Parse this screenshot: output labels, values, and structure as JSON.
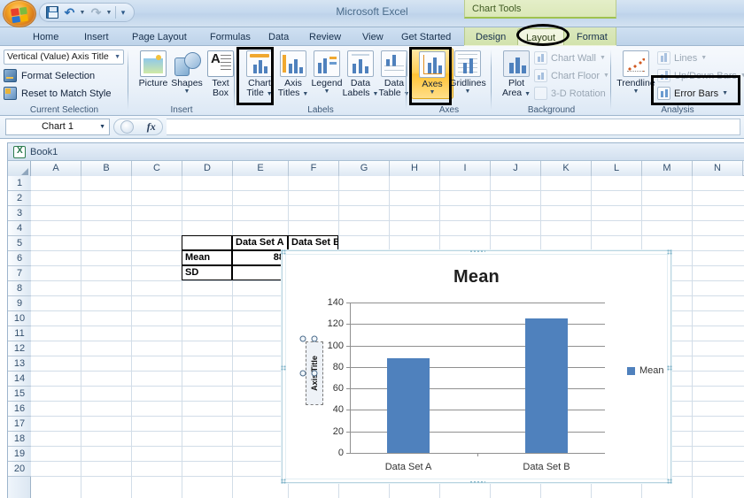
{
  "window": {
    "app_title": "Microsoft Excel",
    "contextual_tools_label": "Chart Tools",
    "workbook_name": "Book1"
  },
  "quick_access": {
    "office_button": "Office Button",
    "save": "Save",
    "undo": "Undo",
    "redo": "Redo",
    "customize": "Customize Quick Access Toolbar"
  },
  "tabs": [
    {
      "label": "Home",
      "active": false
    },
    {
      "label": "Insert",
      "active": false
    },
    {
      "label": "Page Layout",
      "active": false
    },
    {
      "label": "Formulas",
      "active": false
    },
    {
      "label": "Data",
      "active": false
    },
    {
      "label": "Review",
      "active": false
    },
    {
      "label": "View",
      "active": false
    },
    {
      "label": "Get Started",
      "active": false
    },
    {
      "label": "Design",
      "active": false
    },
    {
      "label": "Layout",
      "active": true
    },
    {
      "label": "Format",
      "active": false
    }
  ],
  "ribbon": {
    "groups": [
      {
        "label": "Current Selection"
      },
      {
        "label": "Insert"
      },
      {
        "label": "Labels"
      },
      {
        "label": "Axes"
      },
      {
        "label": "Background"
      },
      {
        "label": "Analysis"
      }
    ],
    "current_selection": {
      "selected_element": "Vertical (Value) Axis Title",
      "format_selection": "Format Selection",
      "reset_to_match_style": "Reset to Match Style"
    },
    "insert": {
      "picture": "Picture",
      "shapes_l1": "Shapes",
      "text_box_l1": "Text",
      "text_box_l2": "Box"
    },
    "labels": {
      "chart_title_l1": "Chart",
      "chart_title_l2": "Title",
      "axis_titles_l1": "Axis",
      "axis_titles_l2": "Titles",
      "legend": "Legend",
      "data_labels_l1": "Data",
      "data_labels_l2": "Labels",
      "data_table_l1": "Data",
      "data_table_l2": "Table"
    },
    "axes": {
      "axes": "Axes",
      "gridlines": "Gridlines"
    },
    "background": {
      "plot_area_l1": "Plot",
      "plot_area_l2": "Area",
      "chart_wall": "Chart Wall",
      "chart_floor": "Chart Floor",
      "three_d_rotation": "3-D Rotation"
    },
    "analysis": {
      "trendline": "Trendline",
      "lines": "Lines",
      "up_down_bars": "Up/Down Bars",
      "error_bars": "Error Bars"
    }
  },
  "formula_bar": {
    "name_box_value": "Chart 1",
    "formula_value": "",
    "fx_label": "fx"
  },
  "sheet": {
    "columns": [
      "A",
      "B",
      "C",
      "D",
      "E",
      "F",
      "G",
      "H",
      "I",
      "J",
      "K",
      "L",
      "M",
      "N"
    ],
    "rows": [
      "1",
      "2",
      "3",
      "4",
      "5",
      "6",
      "7",
      "8",
      "9",
      "10",
      "11",
      "12",
      "13",
      "14",
      "15",
      "16",
      "17",
      "18",
      "19",
      "20"
    ],
    "data_cells": [
      {
        "ref": "D5",
        "value": "",
        "col": 3,
        "row": 5,
        "align": "left"
      },
      {
        "ref": "E5",
        "value": "Data Set A",
        "col": 4,
        "row": 5,
        "align": "left"
      },
      {
        "ref": "F5",
        "value": "Data Set B",
        "col": 5,
        "row": 5,
        "align": "left"
      },
      {
        "ref": "D6",
        "value": "Mean",
        "col": 3,
        "row": 6,
        "align": "left"
      },
      {
        "ref": "E6",
        "value": "88",
        "col": 4,
        "row": 6,
        "align": "right"
      },
      {
        "ref": "D7",
        "value": "SD",
        "col": 3,
        "row": 7,
        "align": "left"
      }
    ]
  },
  "chart_data": {
    "type": "bar",
    "title": "Mean",
    "categories": [
      "Data Set A",
      "Data Set B"
    ],
    "series": [
      {
        "name": "Mean",
        "values": [
          88,
          125.5
        ],
        "color": "#4f81bd"
      }
    ],
    "xlabel": "",
    "ylabel": "Axis Title",
    "ylim": [
      0,
      140
    ],
    "yticks": [
      0,
      20,
      40,
      60,
      80,
      100,
      120,
      140
    ],
    "grid": true,
    "legend_position": "right",
    "legend_entries": [
      "Mean"
    ],
    "selected_element": "Axis Title"
  },
  "annotations": {
    "highlight_layout_tab": "Layout",
    "highlight_chart_title": "Chart Title",
    "highlight_axes": "Axes",
    "highlight_error_bars": "Error Bars"
  },
  "colors": {
    "series_blue": "#4f81bd",
    "ribbon_active": "#ffc234",
    "chart_selection": "#9ec9d8"
  }
}
